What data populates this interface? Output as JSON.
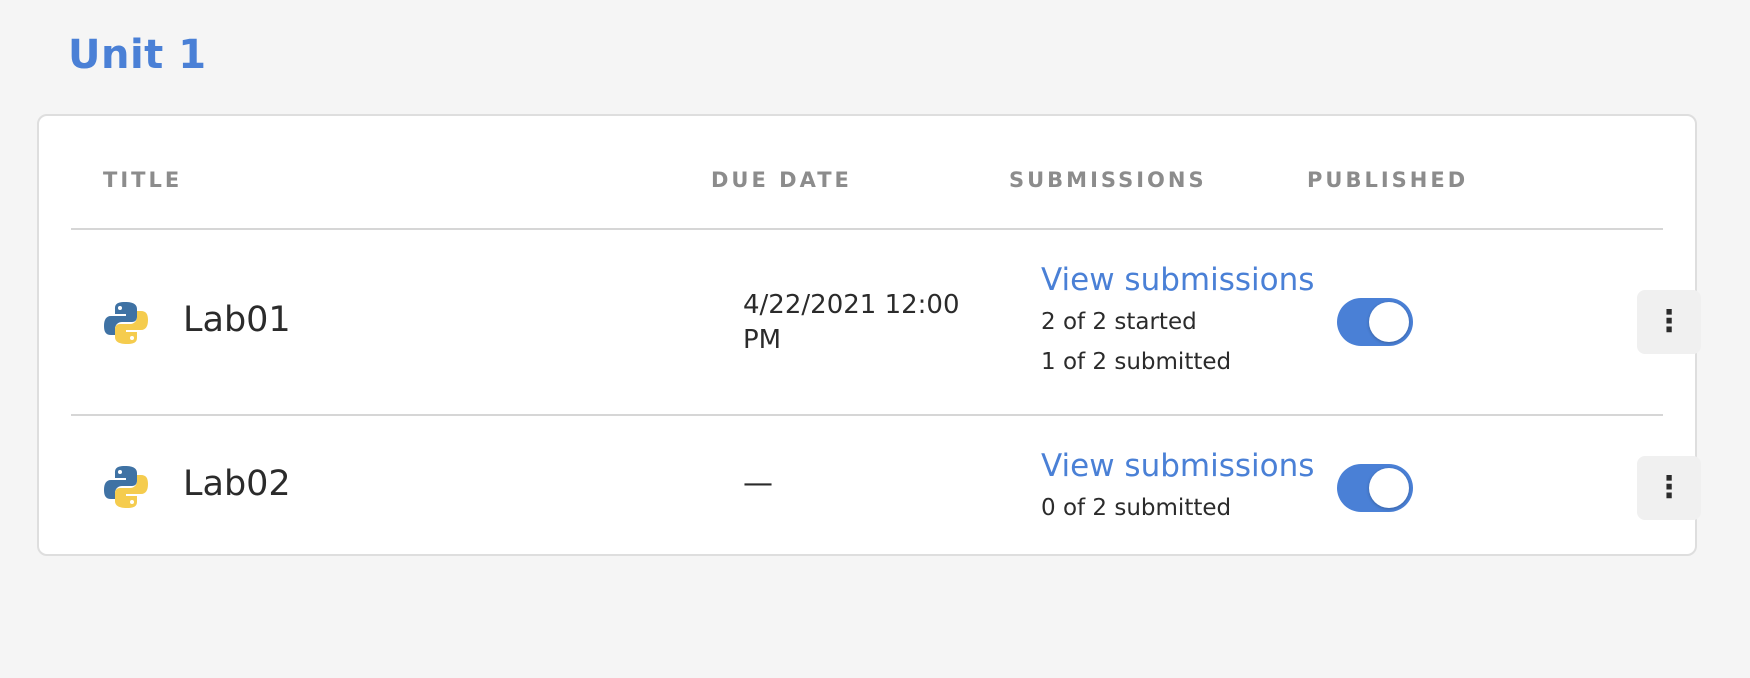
{
  "unit": {
    "title": "Unit 1"
  },
  "table": {
    "headers": {
      "title": "TITLE",
      "due_date": "DUE DATE",
      "submissions": "SUBMISSIONS",
      "published": "PUBLISHED"
    },
    "rows": [
      {
        "icon": "python-icon",
        "title": "Lab01",
        "due_date": "4/22/2021 12:00 PM",
        "view_link": "View submissions",
        "stats": [
          "2 of 2 started",
          "1 of 2 submitted"
        ],
        "published": true,
        "more_icon": "more-vertical-icon"
      },
      {
        "icon": "python-icon",
        "title": "Lab02",
        "due_date": "—",
        "view_link": "View submissions",
        "stats": [
          "0 of 2 submitted"
        ],
        "published": true,
        "more_icon": "more-vertical-icon"
      }
    ]
  },
  "colors": {
    "accent": "#4a80d6",
    "python_blue": "#3f72a4",
    "python_yellow": "#f5cc4e"
  }
}
